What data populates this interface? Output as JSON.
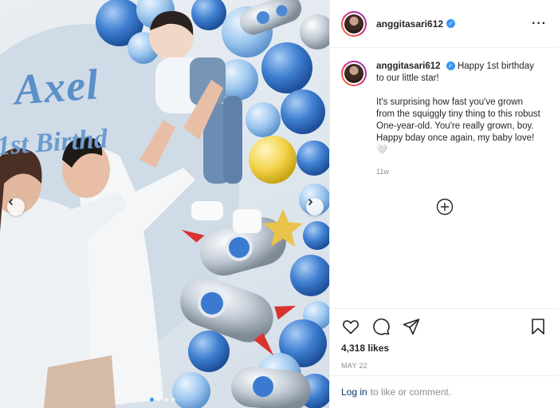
{
  "post": {
    "username": "anggitasari612",
    "verified": true,
    "photo": {
      "backdrop_name": "Axel",
      "backdrop_sub": "1st Birthd",
      "slide_count": 4,
      "active_slide": 1
    }
  },
  "caption": {
    "username": "anggitasari612",
    "first_line": "Happy 1st birthday to our little star!",
    "body": "It's surprising how fast you've grown from the squiggly tiny thing to this robust One-year-old. You're really grown, boy. Happy bday once again, my baby love! 🤍",
    "time": "11w"
  },
  "stats": {
    "likes": "4,318 likes",
    "date": "MAY 22"
  },
  "login": {
    "link": "Log in",
    "rest": "to like or comment."
  },
  "icons": [
    "more-options-icon",
    "heart-icon",
    "comment-icon",
    "share-icon",
    "save-icon",
    "add-comment-icon",
    "chevron-left-icon",
    "chevron-right-icon"
  ],
  "colors": {
    "accent": "#3897f0",
    "link": "#00376b",
    "muted": "#8e8e8e"
  }
}
